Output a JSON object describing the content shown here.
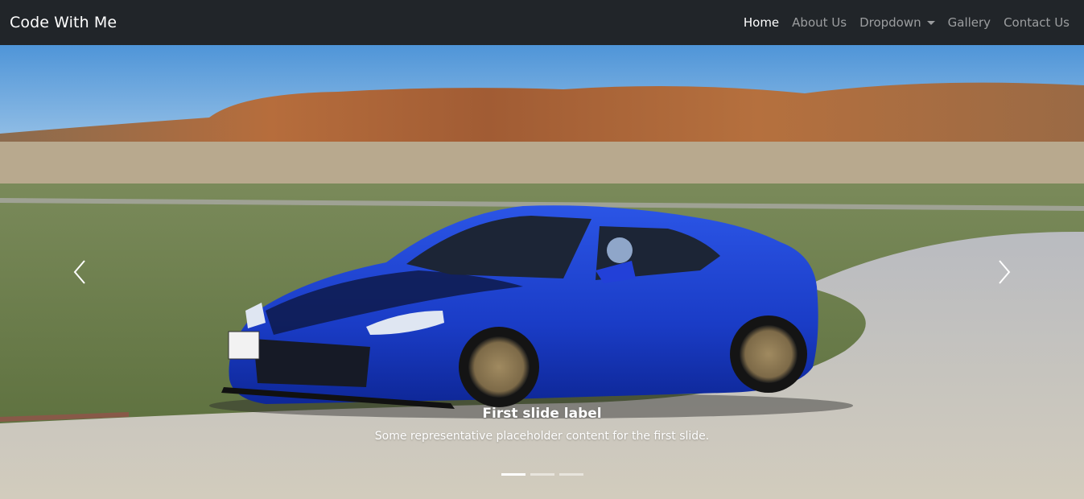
{
  "navbar": {
    "brand": "Code With Me",
    "links": [
      {
        "label": "Home",
        "active": true
      },
      {
        "label": "About Us"
      },
      {
        "label": "Dropdown"
      },
      {
        "label": "Gallery"
      },
      {
        "label": "Contact Us"
      }
    ]
  },
  "carousel": {
    "slide": {
      "title": "First slide label",
      "text": "Some representative placeholder content for the first slide."
    },
    "indicator_count": 3,
    "active_index": 0
  },
  "colors": {
    "navbar_bg": "#212529",
    "car_blue": "#1d3fd0"
  },
  "icons": {
    "prev": "chevron-left-icon",
    "next": "chevron-right-icon",
    "dropdown": "caret-down-icon"
  }
}
